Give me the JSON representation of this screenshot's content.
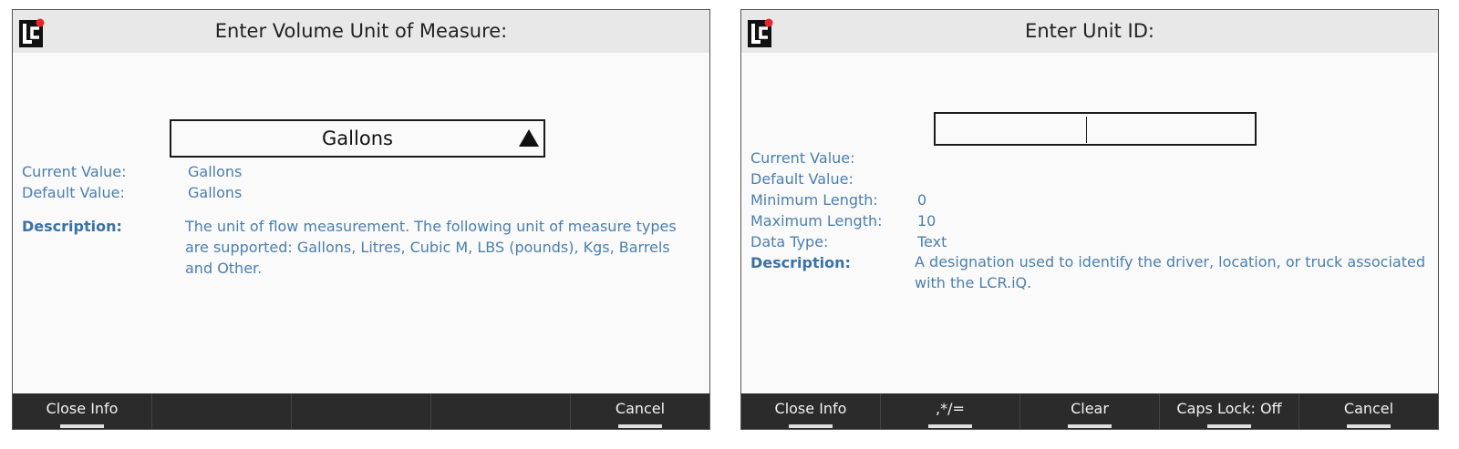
{
  "left_screen": {
    "title": "Enter Volume Unit of Measure:",
    "selector": {
      "value": "Gallons"
    },
    "current_value_label": "Current Value:",
    "current_value": "Gallons",
    "default_value_label": "Default Value:",
    "default_value": "Gallons",
    "description_label": "Description:",
    "description": "The unit of flow measurement. The following unit of measure types are supported: Gallons, Litres, Cubic M, LBS (pounds), Kgs, Barrels and Other.",
    "softkeys": [
      "Close Info",
      "",
      "",
      "",
      "Cancel"
    ]
  },
  "right_screen": {
    "title": "Enter Unit ID:",
    "input": {
      "value": ""
    },
    "current_value_label": "Current Value:",
    "current_value": "",
    "default_value_label": "Default Value:",
    "default_value": "",
    "min_length_label": "Minimum Length:",
    "min_length": "0",
    "max_length_label": "Maximum Length:",
    "max_length": "10",
    "data_type_label": "Data Type:",
    "data_type": "Text",
    "description_label": "Description:",
    "description": "A designation used to identify the driver, location, or truck associated with the LCR.iQ.",
    "softkeys": [
      "Close Info",
      ",*/=",
      "Clear",
      "Caps Lock: Off",
      "Cancel"
    ]
  },
  "colors": {
    "header_bg": "#e8e8e8",
    "softkey_bg": "#2b2b2b",
    "info_text": "#4a7fb0",
    "logo_red": "#e8262e"
  },
  "icons": {
    "logo": "lc-logo-icon",
    "dropdown": "triangle-up-icon"
  }
}
